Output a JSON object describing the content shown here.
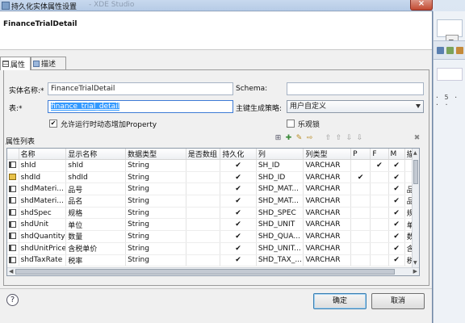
{
  "window": {
    "title": "持久化实体属性设置",
    "title_faint": "- XDE Studio",
    "close_glyph": "×"
  },
  "header": {
    "title": "FinanceTrialDetail"
  },
  "tabs": [
    {
      "label": "属性",
      "icon": "grid-icon"
    },
    {
      "label": "描述",
      "icon": "doc-icon"
    }
  ],
  "form": {
    "entity_name_label": "实体名称:*",
    "entity_name_value": "FinanceTrialDetail",
    "schema_label": "Schema:",
    "schema_value": "",
    "table_label": "表:*",
    "table_value": "finance_trial_detail",
    "pk_strategy_label": "主键生成策略:",
    "pk_strategy_value": "用户自定义",
    "allow_runtime_label": "允许运行时动态增加Property",
    "allow_runtime_checked": "✔",
    "optimistic_lock_label": "乐观锁",
    "optimistic_lock_checked": ""
  },
  "property_list": {
    "title": "属性列表",
    "toolbar_icons": [
      "add-row-icon",
      "add-column-icon",
      "edit-icon",
      "import-icon",
      "move-top-icon",
      "move-up-icon",
      "move-down-icon",
      "move-bottom-icon",
      "delete-icon"
    ],
    "toolbar_glyphs": [
      "⊞",
      "✚",
      "✎",
      "⇨",
      "⇧",
      "⇧",
      "⇩",
      "⇩",
      "✖"
    ],
    "columns": [
      "",
      "名称",
      "显示名称",
      "数据类型",
      "是否数组",
      "持久化",
      "列",
      "列类型",
      "P",
      "F",
      "M",
      "描"
    ],
    "rows": [
      {
        "icon": "field",
        "name": "shId",
        "display": "shId",
        "type": "String",
        "array": "",
        "persist": "✔",
        "column": "SH_ID",
        "coltype": "VARCHAR",
        "p": "",
        "f": "✔",
        "m": "✔",
        "desc": ""
      },
      {
        "icon": "key",
        "name": "shdId",
        "display": "shdId",
        "type": "String",
        "array": "",
        "persist": "✔",
        "column": "SHD_ID",
        "coltype": "VARCHAR",
        "p": "✔",
        "f": "",
        "m": "✔",
        "desc": ""
      },
      {
        "icon": "field",
        "name": "shdMateri...",
        "display": "品号",
        "type": "String",
        "array": "",
        "persist": "✔",
        "column": "SHD_MAT...",
        "coltype": "VARCHAR",
        "p": "",
        "f": "",
        "m": "✔",
        "desc": "品"
      },
      {
        "icon": "field",
        "name": "shdMateri...",
        "display": "品名",
        "type": "String",
        "array": "",
        "persist": "✔",
        "column": "SHD_MAT...",
        "coltype": "VARCHAR",
        "p": "",
        "f": "",
        "m": "✔",
        "desc": "品"
      },
      {
        "icon": "field",
        "name": "shdSpec",
        "display": "规格",
        "type": "String",
        "array": "",
        "persist": "✔",
        "column": "SHD_SPEC",
        "coltype": "VARCHAR",
        "p": "",
        "f": "",
        "m": "✔",
        "desc": "规"
      },
      {
        "icon": "field",
        "name": "shdUnit",
        "display": "单位",
        "type": "String",
        "array": "",
        "persist": "✔",
        "column": "SHD_UNIT",
        "coltype": "VARCHAR",
        "p": "",
        "f": "",
        "m": "✔",
        "desc": "单"
      },
      {
        "icon": "field",
        "name": "shdQuantity",
        "display": "数量",
        "type": "String",
        "array": "",
        "persist": "✔",
        "column": "SHD_QUA...",
        "coltype": "VARCHAR",
        "p": "",
        "f": "",
        "m": "✔",
        "desc": "数"
      },
      {
        "icon": "field",
        "name": "shdUnitPrice",
        "display": "含税单价",
        "type": "String",
        "array": "",
        "persist": "✔",
        "column": "SHD_UNIT...",
        "coltype": "VARCHAR",
        "p": "",
        "f": "",
        "m": "✔",
        "desc": "含"
      },
      {
        "icon": "field",
        "name": "shdTaxRate",
        "display": "税率",
        "type": "String",
        "array": "",
        "persist": "✔",
        "column": "SHD_TAX_...",
        "coltype": "VARCHAR",
        "p": "",
        "f": "",
        "m": "✔",
        "desc": "税"
      }
    ]
  },
  "footer": {
    "help_glyph": "?",
    "ok_label": "确定",
    "cancel_label": "取消"
  },
  "background": {
    "tab_glyph": "≡",
    "ruler_text": "· 5 · · ·"
  }
}
